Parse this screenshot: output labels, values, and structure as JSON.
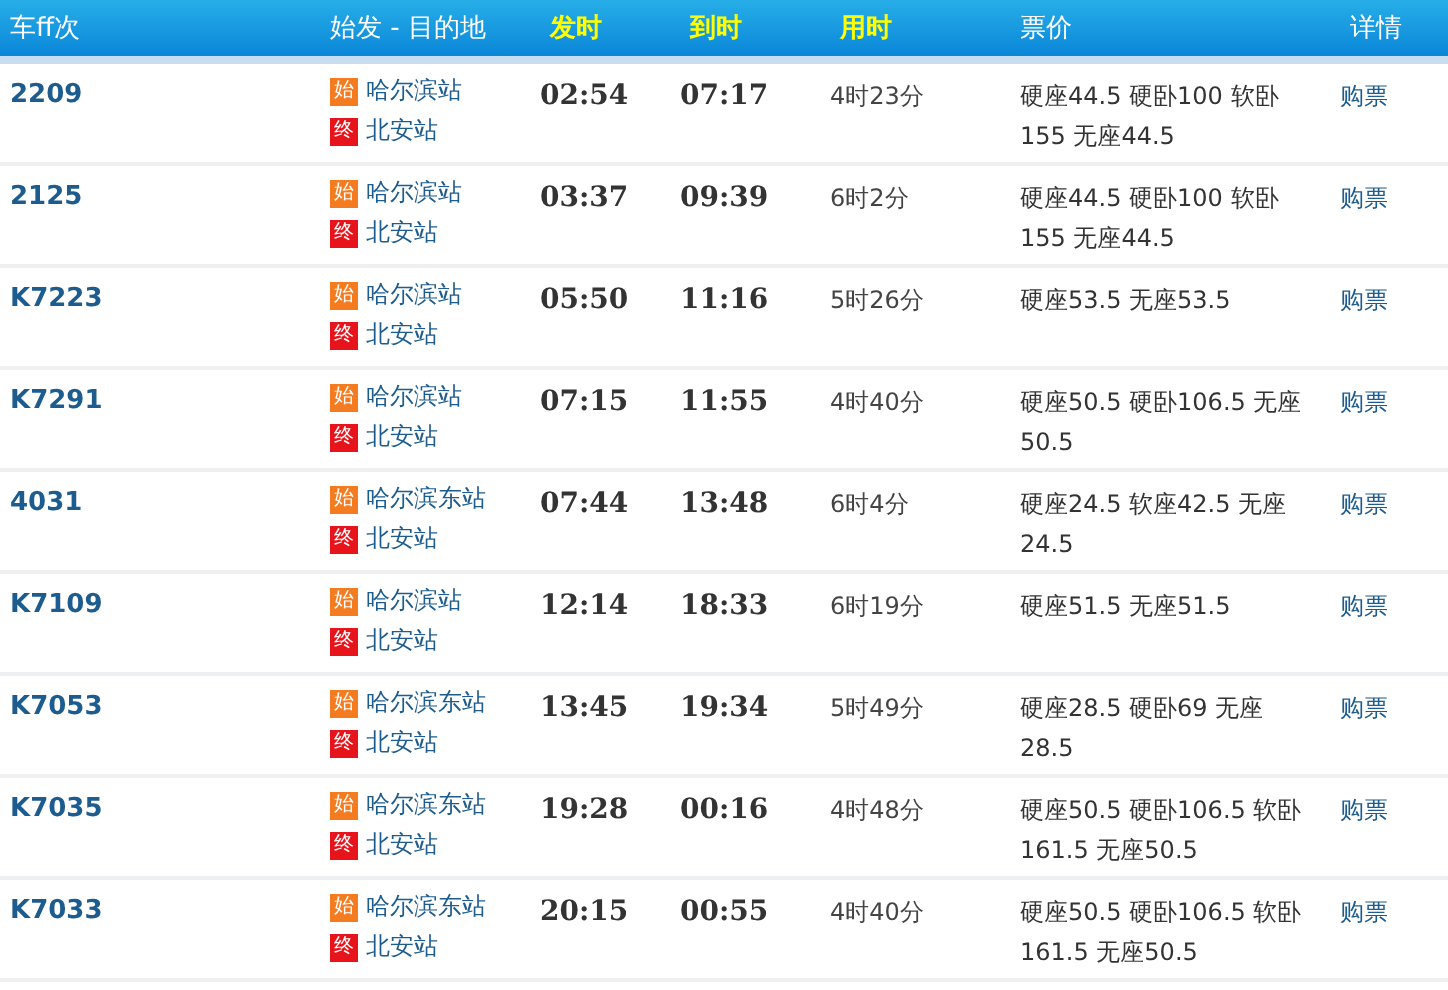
{
  "table": {
    "columns": [
      {
        "label": "车ff次",
        "highlight": false
      },
      {
        "label": "始发 - 目的地",
        "highlight": false
      },
      {
        "label": "发时",
        "highlight": true
      },
      {
        "label": "到时",
        "highlight": true
      },
      {
        "label": "用时",
        "highlight": true
      },
      {
        "label": "票价",
        "highlight": false
      },
      {
        "label": "详情",
        "highlight": false
      }
    ],
    "rows": [
      {
        "train": "2209",
        "start_badge": "始",
        "from": "哈尔滨站",
        "end_badge": "终",
        "to": "北安站",
        "depart": "02:54",
        "arrive": "07:17",
        "duration": "4时23分",
        "price": "硬座44.5 硬卧100 软卧155 无座44.5",
        "action": "购票"
      },
      {
        "train": "2125",
        "start_badge": "始",
        "from": "哈尔滨站",
        "end_badge": "终",
        "to": "北安站",
        "depart": "03:37",
        "arrive": "09:39",
        "duration": "6时2分",
        "price": "硬座44.5 硬卧100 软卧155 无座44.5",
        "action": "购票"
      },
      {
        "train": "K7223",
        "start_badge": "始",
        "from": "哈尔滨站",
        "end_badge": "终",
        "to": "北安站",
        "depart": "05:50",
        "arrive": "11:16",
        "duration": "5时26分",
        "price": "硬座53.5 无座53.5",
        "action": "购票"
      },
      {
        "train": "K7291",
        "start_badge": "始",
        "from": "哈尔滨站",
        "end_badge": "终",
        "to": "北安站",
        "depart": "07:15",
        "arrive": "11:55",
        "duration": "4时40分",
        "price": "硬座50.5 硬卧106.5 无座50.5",
        "action": "购票"
      },
      {
        "train": "4031",
        "start_badge": "始",
        "from": "哈尔滨东站",
        "end_badge": "终",
        "to": "北安站",
        "depart": "07:44",
        "arrive": "13:48",
        "duration": "6时4分",
        "price": "硬座24.5 软座42.5 无座24.5",
        "action": "购票"
      },
      {
        "train": "K7109",
        "start_badge": "始",
        "from": "哈尔滨站",
        "end_badge": "终",
        "to": "北安站",
        "depart": "12:14",
        "arrive": "18:33",
        "duration": "6时19分",
        "price": "硬座51.5 无座51.5",
        "action": "购票"
      },
      {
        "train": "K7053",
        "start_badge": "始",
        "from": "哈尔滨东站",
        "end_badge": "终",
        "to": "北安站",
        "depart": "13:45",
        "arrive": "19:34",
        "duration": "5时49分",
        "price": "硬座28.5 硬卧69 无座28.5",
        "action": "购票"
      },
      {
        "train": "K7035",
        "start_badge": "始",
        "from": "哈尔滨东站",
        "end_badge": "终",
        "to": "北安站",
        "depart": "19:28",
        "arrive": "00:16",
        "duration": "4时48分",
        "price": "硬座50.5 硬卧106.5 软卧161.5 无座50.5",
        "action": "购票"
      },
      {
        "train": "K7033",
        "start_badge": "始",
        "from": "哈尔滨东站",
        "end_badge": "终",
        "to": "北安站",
        "depart": "20:15",
        "arrive": "00:55",
        "duration": "4时40分",
        "price": "硬座50.5 硬卧106.5 软卧161.5 无座50.5",
        "action": "购票"
      }
    ]
  }
}
